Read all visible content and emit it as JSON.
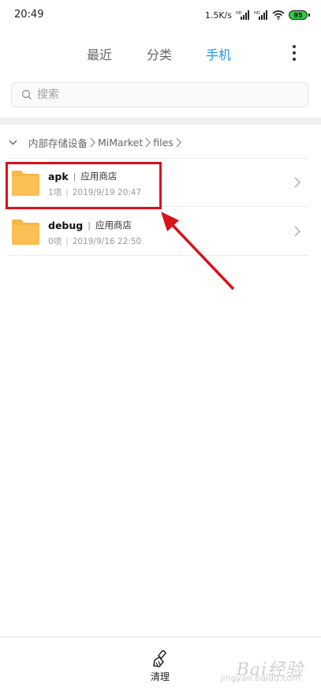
{
  "status_bar": {
    "time": "20:49",
    "net_speed": "1.5K/s",
    "battery": "95",
    "icons": [
      "signal-icon",
      "signal-icon",
      "wifi-icon",
      "battery-icon"
    ]
  },
  "tabs": [
    {
      "label": "最近",
      "active": false
    },
    {
      "label": "分类",
      "active": false
    },
    {
      "label": "手机",
      "active": true
    }
  ],
  "search": {
    "placeholder": "搜索"
  },
  "breadcrumb": {
    "segments": [
      "内部存储设备",
      "MiMarket",
      "files"
    ]
  },
  "files": [
    {
      "name": "apk",
      "owner": "应用商店",
      "count": "1项",
      "date": "2019/9/19 20:47"
    },
    {
      "name": "debug",
      "owner": "应用商店",
      "count": "0项",
      "date": "2019/9/16 22:50"
    }
  ],
  "bottom_bar": {
    "clean_label": "清理"
  },
  "watermark": {
    "text": "Bai经验",
    "sub": "jingyan.baidu.com"
  },
  "colors": {
    "accent": "#2196f3",
    "folder": "#f8b84a",
    "annotation": "#d9121b",
    "battery": "#2ecc40"
  }
}
